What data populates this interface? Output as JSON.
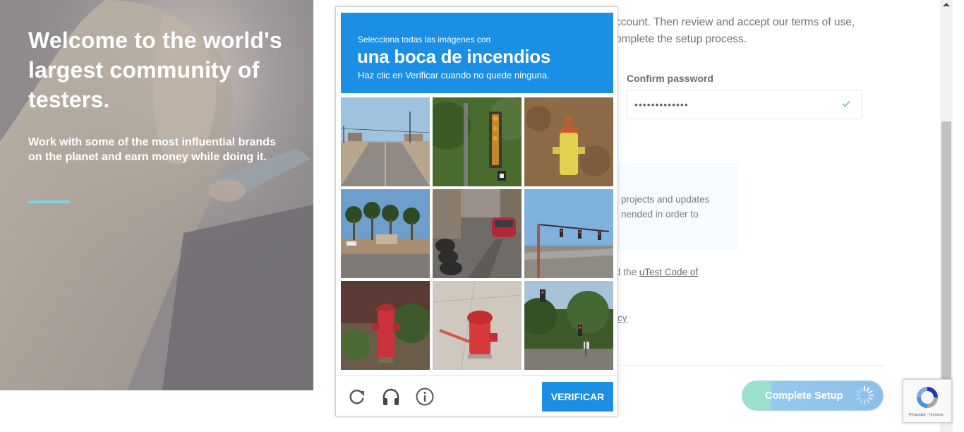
{
  "hero": {
    "title": "Welcome to the world's largest community of testers.",
    "subtitle": "Work with some of the most influential brands on the planet and earn money while doing it."
  },
  "form": {
    "intro_text": "ccount. Then review and accept our terms of use, omplete the setup process.",
    "confirm_password_label": "Confirm password",
    "confirm_password_value": "•••••••••••••",
    "notice_text": "projects and updates nended in order to",
    "code_prefix": "d the ",
    "code_link": "uTest Code of",
    "policy_text": "icy",
    "complete_button": "Complete Setup"
  },
  "captcha": {
    "instruction_line1": "Selecciona todas las imágenes con",
    "target_object": "una boca de incendios",
    "instruction_line3": "Haz clic en Verificar cuando no quede ninguna.",
    "verify_button": "VERIFICAR",
    "tiles": [
      {
        "scene": "desert-road"
      },
      {
        "scene": "traffic-light"
      },
      {
        "scene": "yellow-hydrant"
      },
      {
        "scene": "palm-trees-road"
      },
      {
        "scene": "street-motorcycles"
      },
      {
        "scene": "intersection-lights"
      },
      {
        "scene": "red-hydrant-bushes"
      },
      {
        "scene": "red-hydrant-sidewalk"
      },
      {
        "scene": "traffic-light-trees"
      }
    ],
    "icons": [
      "reload-icon",
      "headphones-icon",
      "info-icon"
    ]
  },
  "recaptcha_badge": {
    "links": "Privacidad - Términos"
  },
  "colors": {
    "captcha_blue": "#1a8fe3",
    "hero_rule": "#7fd3e8",
    "button_gradient_start": "#9be0cc",
    "button_gradient_end": "#8fbfe9"
  }
}
